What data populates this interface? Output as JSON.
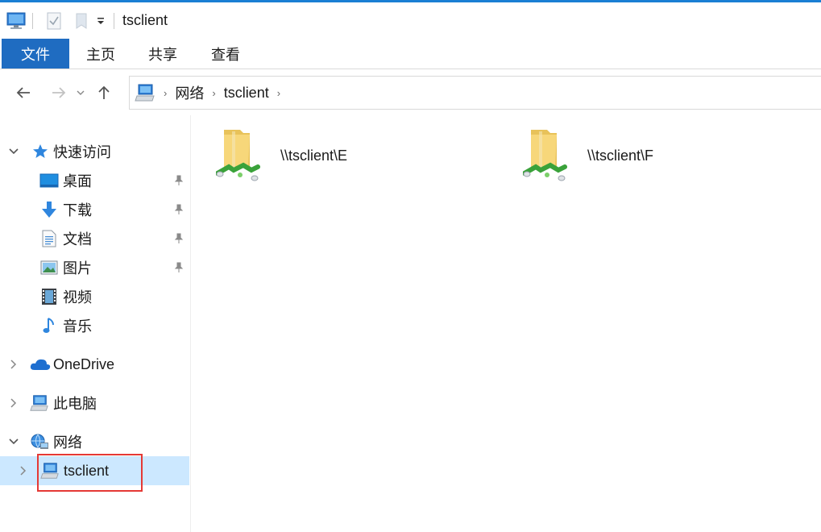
{
  "window": {
    "title": "tsclient"
  },
  "quick_access_toolbar": {
    "icons": [
      "computer-icon",
      "properties-icon",
      "new-folder-icon",
      "customize-dropdown-icon"
    ]
  },
  "ribbon": {
    "tabs": [
      {
        "label": "文件",
        "active": true
      },
      {
        "label": "主页"
      },
      {
        "label": "共享"
      },
      {
        "label": "查看"
      }
    ]
  },
  "address_bar": {
    "breadcrumbs": [
      "网络",
      "tsclient"
    ]
  },
  "sidebar": {
    "quick_access": {
      "label": "快速访问",
      "expanded": true,
      "items": [
        {
          "label": "桌面",
          "icon": "desktop-icon",
          "pinned": true
        },
        {
          "label": "下载",
          "icon": "download-icon",
          "pinned": true
        },
        {
          "label": "文档",
          "icon": "documents-icon",
          "pinned": true
        },
        {
          "label": "图片",
          "icon": "pictures-icon",
          "pinned": true
        },
        {
          "label": "视频",
          "icon": "videos-icon",
          "pinned": false
        },
        {
          "label": "音乐",
          "icon": "music-icon",
          "pinned": false
        }
      ]
    },
    "onedrive": {
      "label": "OneDrive",
      "expanded": false
    },
    "this_pc": {
      "label": "此电脑",
      "expanded": false
    },
    "network": {
      "label": "网络",
      "expanded": true,
      "children": [
        {
          "label": "tsclient",
          "selected": true
        }
      ]
    }
  },
  "content": {
    "items": [
      {
        "label": "\\\\tsclient\\E",
        "icon": "network-share-folder-icon"
      },
      {
        "label": "\\\\tsclient\\F",
        "icon": "network-share-folder-icon"
      }
    ]
  },
  "colors": {
    "accent": "#1f6cc1",
    "selection": "#cce8ff",
    "highlight_box": "#e53935"
  }
}
